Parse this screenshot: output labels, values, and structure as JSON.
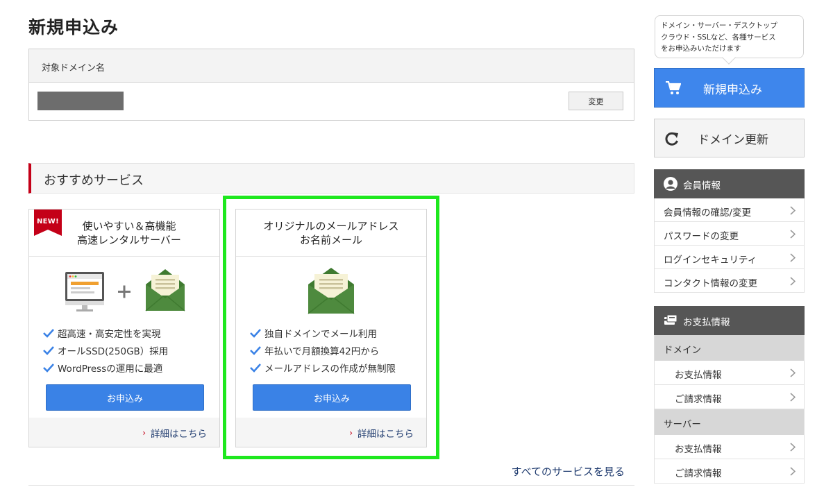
{
  "page": {
    "title": "新規申込み"
  },
  "domain": {
    "header": "対象ドメイン名",
    "change_label": "変更"
  },
  "recommended": {
    "section_title": "おすすめサービス",
    "cards": [
      {
        "badge": "NEW!",
        "title": "使いやすい＆高機能\n高速レンタルサーバー",
        "features": [
          "超高速・高安定性を実現",
          "オールSSD(250GB）採用",
          "WordPressの運用に最適"
        ],
        "apply_label": "お申込み",
        "detail_label": "詳細はこちら"
      },
      {
        "title": "オリジナルのメールアドレス\nお名前メール",
        "features": [
          "独自ドメインでメール利用",
          "年払いで月額換算42円から",
          "メールアドレスの作成が無制限"
        ],
        "apply_label": "お申込み",
        "detail_label": "詳細はこちら"
      }
    ],
    "all_services_link": "すべてのサービスを見る"
  },
  "sidebar": {
    "bubble_text": "ドメイン・サーバー・デスクトップ\nクラウド・SSLなど、各種サービス\nをお申込みいただけます",
    "new_apply_label": "新規申込み",
    "renew_label": "ドメイン更新",
    "member": {
      "title": "会員情報",
      "items": [
        "会員情報の確認/変更",
        "パスワードの変更",
        "ログインセキュリティ",
        "コンタクト情報の変更"
      ]
    },
    "payment": {
      "title": "お支払情報",
      "groups": [
        {
          "name": "ドメイン",
          "items": [
            "お支払情報",
            "ご請求情報"
          ]
        },
        {
          "name": "サーバー",
          "items": [
            "お支払情報",
            "ご請求情報"
          ]
        }
      ]
    }
  },
  "colors": {
    "accent_blue": "#3e86ec",
    "brand_red": "#c40018",
    "highlight_green": "#1ee81e",
    "envelope_green": "#4e8a3e",
    "panel_gray": "#565656"
  },
  "icons": {
    "cart": "cart-icon",
    "renew": "refresh-icon",
    "member": "user-icon",
    "payment": "payment-card-icon",
    "check": "check-icon",
    "arrow": "chevron-right-icon"
  }
}
